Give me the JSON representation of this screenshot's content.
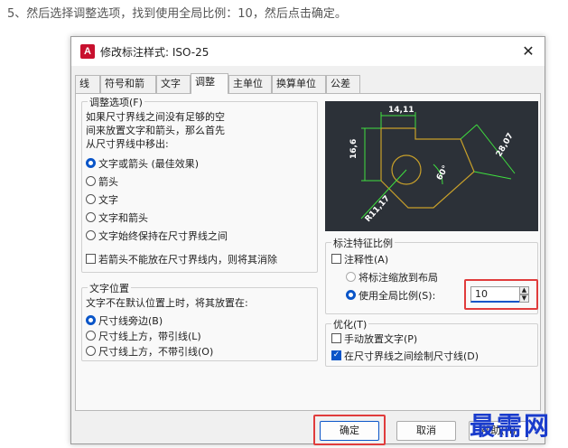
{
  "caption": "5、然后选择调整选项，找到使用全局比例：10，然后点击确定。",
  "dialog": {
    "app_icon_letter": "A",
    "title": "修改标注样式: ISO-25",
    "close_symbol": "✕",
    "tabs": [
      "线",
      "符号和箭头",
      "文字",
      "调整",
      "主单位",
      "换算单位",
      "公差"
    ],
    "active_tab_index": 3
  },
  "fit_options": {
    "title": "调整选项(F)",
    "description": [
      "如果尺寸界线之间没有足够的空",
      "间来放置文字和箭头，那么首先",
      "从尺寸界线中移出:"
    ],
    "radios": [
      "文字或箭头 (最佳效果)",
      "箭头",
      "文字",
      "文字和箭头",
      "文字始终保持在尺寸界线之间"
    ],
    "selected_index": 0,
    "suppress_checkbox": "若箭头不能放在尺寸界线内，则将其消除",
    "suppress_checked": false
  },
  "text_placement": {
    "title": "文字位置",
    "description": "文字不在默认位置上时，将其放置在:",
    "radios": [
      "尺寸线旁边(B)",
      "尺寸线上方，带引线(L)",
      "尺寸线上方，不带引线(O)"
    ],
    "selected_index": 0
  },
  "preview": {
    "dim_top": "14,11",
    "dim_left": "16,6",
    "dim_right": "28,07",
    "dim_angle": "60°",
    "dim_radius": "R11,17"
  },
  "scale": {
    "title": "标注特征比例",
    "annotative_label": "注释性(A)",
    "annotative_checked": false,
    "radio_layout": "将标注缩放到布局",
    "radio_overall": "使用全局比例(S):",
    "selected": "overall",
    "overall_value": "10"
  },
  "fine_tuning": {
    "title": "优化(T)",
    "manual_label": "手动放置文字(P)",
    "manual_checked": false,
    "draw_label": "在尺寸界线之间绘制尺寸线(D)",
    "draw_checked": true,
    "checkmark": "✓"
  },
  "buttons": {
    "ok": "确定",
    "cancel": "取消",
    "help": "帮助(H)"
  },
  "watermark": "最需网",
  "colors": {
    "accent": "#0a55c8",
    "highlight": "#e03c3c",
    "preview_bg": "#2c3138",
    "preview_dim": "#3fe03f",
    "preview_obj": "#c8a02a"
  }
}
